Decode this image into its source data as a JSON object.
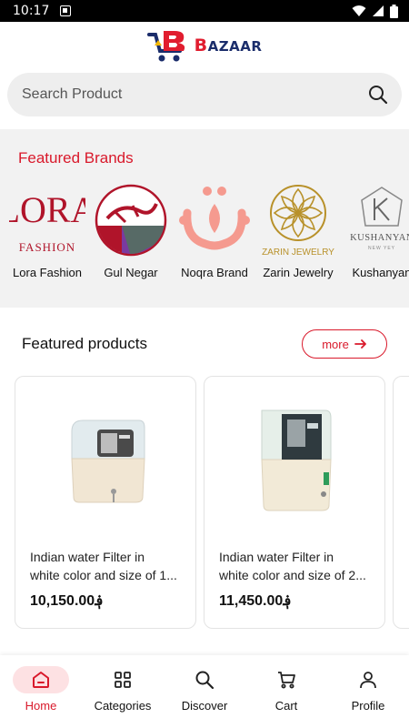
{
  "status_bar": {
    "time": "10:17"
  },
  "header": {
    "logo_text": "AZAAR",
    "logo_letter": "B"
  },
  "search": {
    "placeholder": "Search Product"
  },
  "featured_brands": {
    "title": "Featured Brands",
    "items": [
      {
        "name": "Lora Fashion",
        "logo_text": "LORA",
        "logo_sub": "FASHION"
      },
      {
        "name": "Gul Negar"
      },
      {
        "name": "Noqra Brand"
      },
      {
        "name": "Zarin Jewelry",
        "logo_text": "ZARIN JEWELRY"
      },
      {
        "name": "Kushanyan",
        "logo_text": "KUSHANYAN",
        "logo_sub": "NEW YEY"
      }
    ]
  },
  "featured_products": {
    "title": "Featured products",
    "more_label": "more",
    "items": [
      {
        "name_line1": "Indian water  Filter in",
        "name_line2": "white color and size of 1...",
        "price": "10,150.00؋"
      },
      {
        "name_line1": "Indian water  Filter in",
        "name_line2": "white color and size of 2...",
        "price": "11,450.00؋"
      }
    ]
  },
  "bottom_nav": {
    "items": [
      {
        "label": "Home",
        "icon": "home-icon",
        "active": true
      },
      {
        "label": "Categories",
        "icon": "grid-icon"
      },
      {
        "label": "Discover",
        "icon": "search-icon"
      },
      {
        "label": "Cart",
        "icon": "cart-icon"
      },
      {
        "label": "Profile",
        "icon": "person-icon"
      }
    ]
  },
  "colors": {
    "accent": "#d9192b",
    "navy": "#1b2d6b",
    "gold": "#b8912a",
    "pink": "#f59a8f"
  }
}
